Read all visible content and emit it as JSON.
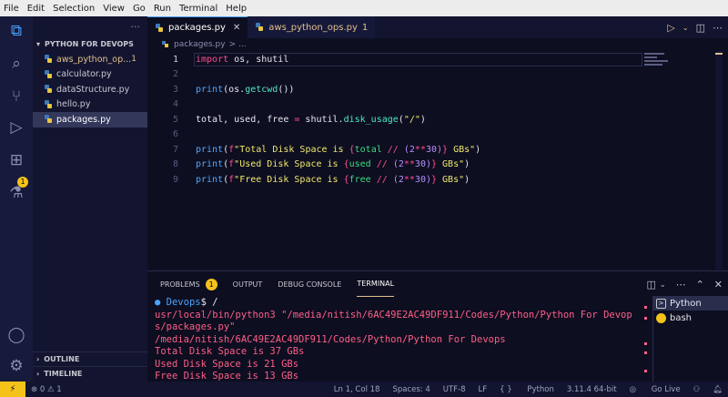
{
  "menu": [
    "File",
    "Edit",
    "Selection",
    "View",
    "Go",
    "Run",
    "Terminal",
    "Help"
  ],
  "sidebar": {
    "dots": "···",
    "folder": "PYTHON FOR DEVOPS",
    "files": [
      {
        "name": "aws_python_op...",
        "badge": "1",
        "modified": true
      },
      {
        "name": "calculator.py"
      },
      {
        "name": "dataStructure.py"
      },
      {
        "name": "hello.py"
      },
      {
        "name": "packages.py",
        "active": true
      }
    ],
    "outline": "OUTLINE",
    "timeline": "TIMELINE"
  },
  "activity_badge": "1",
  "tabs": [
    {
      "label": "packages.py",
      "close": "✕"
    },
    {
      "label": "aws_python_ops.py",
      "count": "1"
    }
  ],
  "breadcrumb": {
    "file": "packages.py",
    "more": "> ..."
  },
  "code": {
    "line_numbers": [
      "1",
      "2",
      "3",
      "4",
      "5",
      "6",
      "7",
      "8",
      "9"
    ],
    "current_line": 1
  },
  "panel": {
    "tabs": [
      "PROBLEMS",
      "OUTPUT",
      "DEBUG CONSOLE",
      "TERMINAL"
    ],
    "problems_count": "1",
    "active_tab": "TERMINAL"
  },
  "terminal": {
    "prompt_cwd": "Devops",
    "prompt_tail": "$ /",
    "lines": [
      "usr/local/bin/python3 \"/media/nitish/6AC49E2AC49DF911/Codes/Python/Python For Devop",
      "s/packages.py\"",
      "/media/nitish/6AC49E2AC49DF911/Codes/Python/Python For Devops",
      "Total Disk Space is 37 GBs",
      "Used Disk Space is 21 GBs",
      "Free Disk Space is 13 GBs"
    ],
    "instances": [
      "Python",
      "bash"
    ]
  },
  "status": {
    "errors": "0",
    "warnings": "1",
    "position": "Ln 1, Col 18",
    "spaces": "Spaces: 4",
    "encoding": "UTF-8",
    "eol": "LF",
    "language": "Python",
    "interpreter": "3.11.4 64-bit",
    "live": "Go Live"
  },
  "colors": {
    "accent": "#f5c21a",
    "keyword": "#ff4d8f",
    "function": "#4fe7c8",
    "string": "#f2e96d",
    "terminal_text": "#ff5f88"
  }
}
